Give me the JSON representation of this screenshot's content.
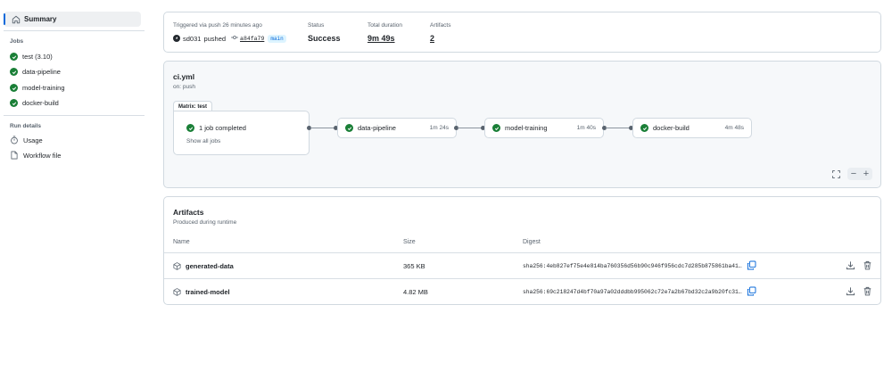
{
  "sidebar": {
    "summary_label": "Summary",
    "jobs_heading": "Jobs",
    "jobs": [
      {
        "label": "test (3.10)",
        "status": "success"
      },
      {
        "label": "data-pipeline",
        "status": "success"
      },
      {
        "label": "model-training",
        "status": "success"
      },
      {
        "label": "docker-build",
        "status": "success"
      }
    ],
    "run_details_heading": "Run details",
    "usage_label": "Usage",
    "workflow_file_label": "Workflow file"
  },
  "summary": {
    "trigger_text": "Triggered via push 26 minutes ago",
    "user": "sd031",
    "action": "pushed",
    "commit": "a84fa79",
    "branch": "main",
    "status_label": "Status",
    "status_value": "Success",
    "duration_label": "Total duration",
    "duration_value": "9m 49s",
    "artifacts_label": "Artifacts",
    "artifacts_value": "2"
  },
  "graph": {
    "workflow_name": "ci.yml",
    "trigger": "on: push",
    "matrix_tab": "Matrix: test",
    "matrix_summary": "1 job completed",
    "matrix_link": "Show all jobs",
    "jobs": [
      {
        "label": "data-pipeline",
        "duration": "1m 24s"
      },
      {
        "label": "model-training",
        "duration": "1m 40s"
      },
      {
        "label": "docker-build",
        "duration": "4m 48s"
      }
    ],
    "zoom_out": "−",
    "zoom_in": "+"
  },
  "artifacts": {
    "title": "Artifacts",
    "subtitle": "Produced during runtime",
    "col_name": "Name",
    "col_size": "Size",
    "col_digest": "Digest",
    "rows": [
      {
        "name": "generated-data",
        "size": "365 KB",
        "digest": "sha256:4eb827ef75e4e814ba760356d56b90c946f956cdc7d285b875861ba41…"
      },
      {
        "name": "trained-model",
        "size": "4.82 MB",
        "digest": "sha256:69c218247d4bf70a97a02dddbb995062c72e7a2b67bd32c2a9b20fc31…"
      }
    ]
  },
  "colors": {
    "accent": "#0969da",
    "success": "#1a7f37",
    "border": "#d1d9e0",
    "muted": "#59636e"
  }
}
